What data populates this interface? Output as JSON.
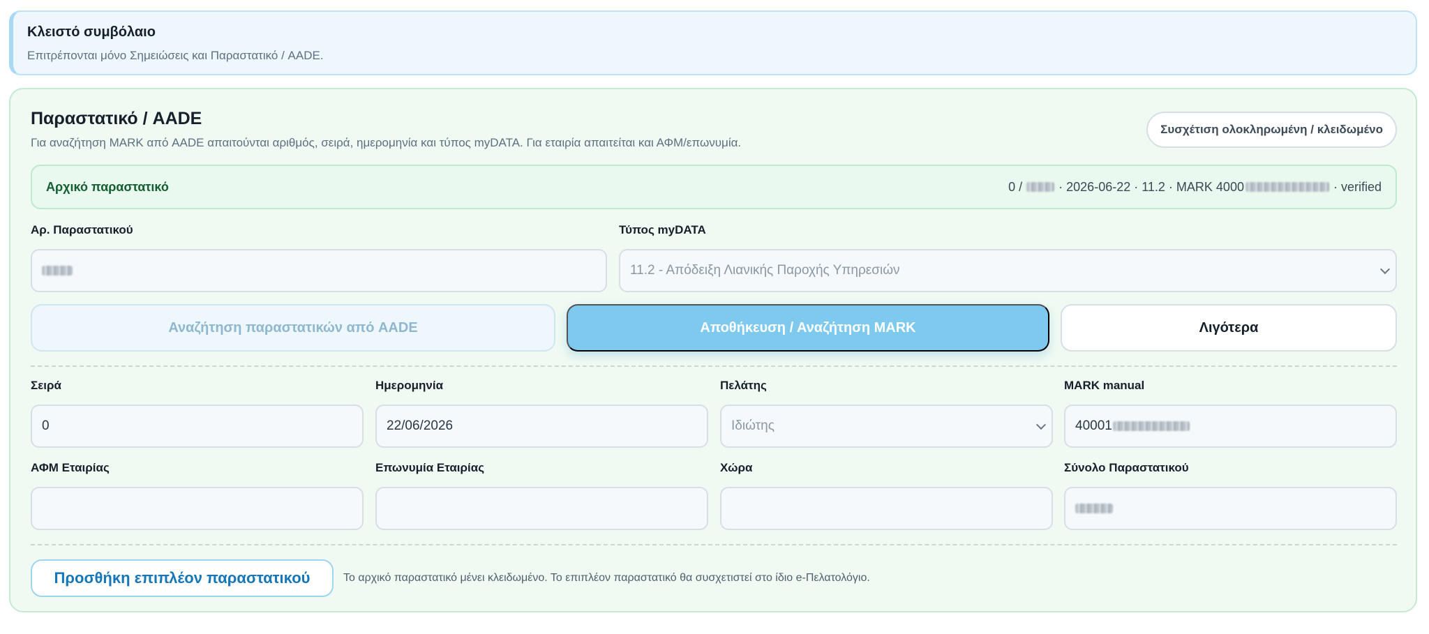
{
  "notice": {
    "title": "Κλειστό συμβόλαιο",
    "text": "Επιτρέπονται μόνο Σημειώσεις και Παραστατικό / AADE."
  },
  "panel": {
    "title": "Παραστατικό / AADE",
    "subtitle": "Για αναζήτηση MARK από AADE απαιτούνται αριθμός, σειρά, ημερομηνία και τύπος myDATA. Για εταιρία απαιτείται και ΑΦΜ/επωνυμία.",
    "lock_label": "Συσχέτιση ολοκληρωμένη / κλειδωμένο"
  },
  "original": {
    "label": "Αρχικό παραστατικό",
    "prefix": "0 /",
    "middle": "· 2026-06-22 · 11.2 · MARK 4000",
    "suffix": "· verified"
  },
  "fields": {
    "doc_number": {
      "label": "Αρ. Παραστατικού",
      "value": ""
    },
    "mydata_type": {
      "label": "Τύπος myDATA",
      "value": "11.2 - Απόδειξη Λιανικής Παροχής Υπηρεσιών"
    },
    "series": {
      "label": "Σειρά",
      "value": "0"
    },
    "date": {
      "label": "Ημερομηνία",
      "value": "22/06/2026"
    },
    "customer": {
      "label": "Πελάτης",
      "value": "Ιδιώτης"
    },
    "mark_manual": {
      "label": "MARK manual",
      "value": "40001"
    },
    "company_vat": {
      "label": "ΑΦΜ Εταιρίας",
      "value": ""
    },
    "company_name": {
      "label": "Επωνυμία Εταιρίας",
      "value": ""
    },
    "country": {
      "label": "Χώρα",
      "value": ""
    },
    "doc_total": {
      "label": "Σύνολο Παραστατικού",
      "value": ""
    }
  },
  "buttons": {
    "search_aade": "Αναζήτηση παραστατικών από AADE",
    "save_search_mark": "Αποθήκευση / Αναζήτηση MARK",
    "less": "Λιγότερα",
    "add_document": "Προσθήκη επιπλέον παραστατικού"
  },
  "add_note": "Το αρχικό παραστατικό μένει κλειδωμένο. Το επιπλέον παραστατικό θα συσχετιστεί στο ίδιο e-Πελατολόγιο."
}
